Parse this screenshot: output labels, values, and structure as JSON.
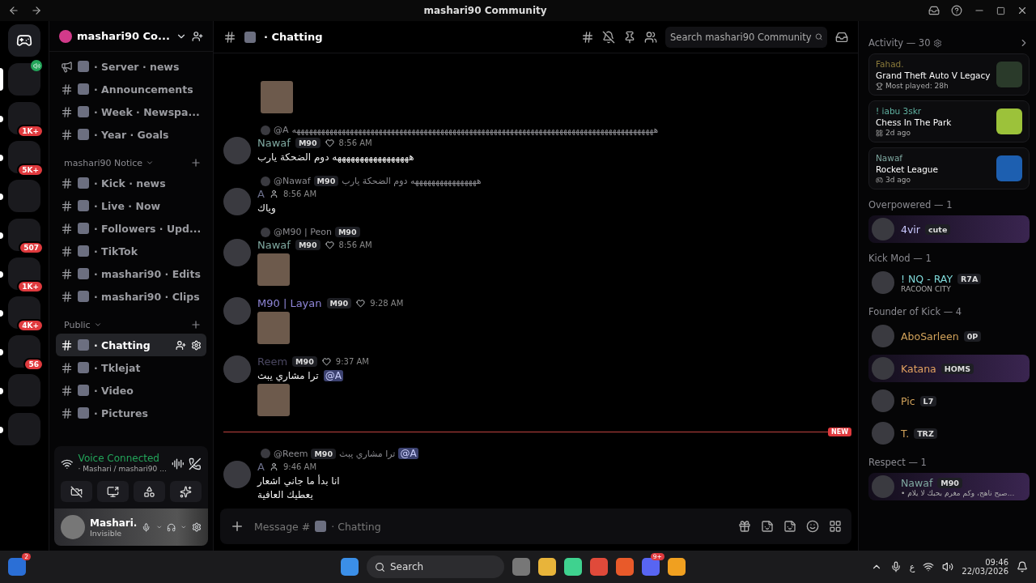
{
  "window": {
    "title": "mashari90 Community"
  },
  "servers": [
    {
      "selected": true,
      "voice": true
    },
    {
      "selected": false,
      "badge": "1K+"
    },
    {
      "selected": false,
      "badge": "5K+"
    },
    {
      "selected": false
    },
    {
      "selected": false,
      "badge": "507"
    },
    {
      "selected": false,
      "badge": "1K+"
    },
    {
      "selected": false,
      "badge": "4K+"
    },
    {
      "selected": false,
      "badge": "56"
    },
    {
      "selected": false
    },
    {
      "selected": false
    }
  ],
  "server_name": "mashari90 Co...",
  "categories": [
    {
      "channels": [
        {
          "kind": "announcement",
          "name": "· Server · news",
          "selected": false
        },
        {
          "kind": "text",
          "name": "· Announcements",
          "selected": false
        },
        {
          "kind": "text",
          "name": "· Week · Newspa...",
          "selected": false
        },
        {
          "kind": "text",
          "name": "· Year · Goals",
          "selected": false
        }
      ]
    },
    {
      "name": "mashari90 Notice",
      "channels": [
        {
          "kind": "text",
          "name": "· Kick · news",
          "selected": false
        },
        {
          "kind": "text",
          "name": "· Live · Now",
          "selected": false
        },
        {
          "kind": "text",
          "name": "· Followers · Upd...",
          "selected": false
        },
        {
          "kind": "text",
          "name": "· TikTok",
          "selected": false
        },
        {
          "kind": "text",
          "name": "· mashari90 · Edits",
          "selected": false
        },
        {
          "kind": "text",
          "name": "· mashari90 · Clips",
          "selected": false
        }
      ]
    },
    {
      "name": "Public",
      "channels": [
        {
          "kind": "text",
          "name": "· Chatting",
          "selected": true
        },
        {
          "kind": "text",
          "name": "· Tklejat",
          "selected": false
        },
        {
          "kind": "text",
          "name": "· Video",
          "selected": false
        },
        {
          "kind": "text",
          "name": "· Pictures",
          "selected": false
        }
      ]
    }
  ],
  "voice": {
    "status": "Voice Connected",
    "channel": "· Mashari / mashari90 ..."
  },
  "user": {
    "name": "Mashari.",
    "status": "Invisible"
  },
  "chat": {
    "channel": "· Chatting",
    "search_placeholder": "Search mashari90 Community",
    "composer_prefix": "Message #",
    "composer_channel": "· Chatting"
  },
  "messages": [
    {
      "kind": "continuation",
      "image": true
    },
    {
      "kind": "message",
      "reply": {
        "author": "@A",
        "text": "ههههههههههههههههههههههههههههههههههههههههههههههههههههههههههههههههههههههههههههههههههههههههه"
      },
      "author": "Nawaf",
      "color": "#7fa8a0",
      "badge": "M90",
      "time": "8:56 AM",
      "lines": [
        "هههههههههههههههههه دوم الضحكة يارب"
      ]
    },
    {
      "kind": "message",
      "reply": {
        "author": "@Nawaf",
        "badge": "M90",
        "text": "ههههههههههههههههه دوم الضحكة يارب"
      },
      "author": "A",
      "color": "#6b6f8a",
      "time": "8:56 AM",
      "lines": [
        "وياك"
      ]
    },
    {
      "kind": "message",
      "reply": {
        "author": "@M90 | Peon",
        "badge": "M90"
      },
      "author": "Nawaf",
      "color": "#7fa8a0",
      "badge": "M90",
      "time": "8:56 AM",
      "image": true
    },
    {
      "kind": "message",
      "author": "M90 | Layan",
      "color": "#8f86d8",
      "badge": "M90",
      "time": "9:28 AM",
      "image": true
    },
    {
      "kind": "message",
      "author": "Reem",
      "color": "#4a4760",
      "badge": "M90",
      "time": "9:37 AM",
      "lines": [
        "ترا مشاري يبث"
      ],
      "mention": "@A",
      "image": true
    },
    {
      "kind": "divider",
      "label": "NEW"
    },
    {
      "kind": "message",
      "reply": {
        "author": "@Reem",
        "badge": "M90",
        "text": "ترا مشاري يبث",
        "mention": "@A"
      },
      "author": "A",
      "color": "#6b6f8a",
      "time": "9:46 AM",
      "lines": [
        "انا بدأ ما جاني اشعار",
        "يعطيك العافية"
      ]
    }
  ],
  "activity": {
    "title": "Activity — 30",
    "cards": [
      {
        "user": "Fahad.",
        "color": "#8a7a3a",
        "game": "Grand Theft Auto V Legacy",
        "kind": "trophy",
        "meta": "Most played: 28h"
      },
      {
        "user": "! iabu 3skr",
        "color": "#5fb0a0",
        "game": "Chess In The Park",
        "kind": "apps",
        "meta": "2d ago"
      },
      {
        "user": "Nawaf",
        "color": "#7fa8a0",
        "game": "Rocket League",
        "kind": "gamepad",
        "meta": "3d ago"
      }
    ]
  },
  "member_groups": [
    {
      "title": "Overpowered — 1",
      "members": [
        {
          "name": "4vir",
          "color": "#c9c9ff",
          "tag": "cute",
          "banner": true
        }
      ]
    },
    {
      "title": "Kick Mod — 1",
      "members": [
        {
          "name": "! NQ - RAY",
          "color": "#7fd8d8",
          "tag": "R7A",
          "status": "RACOON CITY",
          "banner": false
        }
      ]
    },
    {
      "title": "Founder of Kick — 4",
      "members": [
        {
          "name": "AboSarleen",
          "color": "#d1a25a",
          "tag": "0P",
          "banner": false
        },
        {
          "name": "Katana",
          "color": "#e0a060",
          "tag": "HOMS",
          "banner": true
        },
        {
          "name": "Pic",
          "color": "#d1a25a",
          "tag": "L7",
          "banner": false
        },
        {
          "name": "T.",
          "color": "#d1a25a",
          "tag": "TRZ",
          "banner": false
        }
      ]
    },
    {
      "title": "Respect — 1",
      "members": [
        {
          "name": "Nawaf",
          "color": "#7fa8a0",
          "tag": "M90",
          "status": "• صبح ناهج، وكم مغرم بحبك لا يلام...",
          "banner": true
        }
      ]
    }
  ],
  "taskbar": {
    "widget_badge": "2",
    "search": "Search",
    "discord_badge": "9+",
    "language": "ع",
    "time": "09:46",
    "date": "22/03/2026"
  }
}
